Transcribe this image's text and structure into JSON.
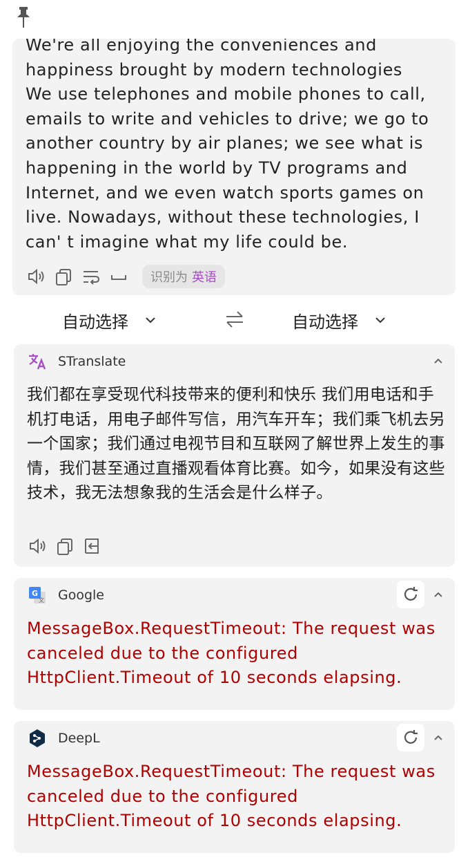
{
  "input": {
    "text": "We're all enjoying the conveniences and\nhappiness brought by modern technologies\nWe use telephones and mobile phones to call,\nemails to write and vehicles to drive; we go to\nanother country by air planes; we see what is\nhappening in the world by TV programs and\nInternet, and we even watch sports games on\nlive. Nowadays, without these technologies, I\ncan' t imagine what my life could be.",
    "detect_prefix": "识别为",
    "detect_lang": "英语",
    "icons": [
      "speaker-icon",
      "copy-icon",
      "wrap-icon",
      "space-icon"
    ]
  },
  "lang_bar": {
    "source": "自动选择",
    "target": "自动选择"
  },
  "services": [
    {
      "name": "STranslate",
      "icon": "stranslate-icon",
      "result": "我们都在享受现代科技带来的便利和快乐 我们用电话和手机打电话，用电子邮件写信，用汽车开车；我们乘飞机去另一个国家；我们通过电视节目和互联网了解世界上发生的事情，我们甚至通过直播观看体育比赛。如今，如果没有这些技术，我无法想象我的生活会是什么样子。"
    },
    {
      "name": "Google",
      "icon": "google-translate-icon",
      "result": "MessageBox.RequestTimeout: The request was canceled due to the configured HttpClient.Timeout of 10 seconds elapsing."
    },
    {
      "name": "DeepL",
      "icon": "deepl-icon",
      "result": "MessageBox.RequestTimeout: The request was canceled due to the configured HttpClient.Timeout of 10 seconds elapsing."
    }
  ],
  "colors": {
    "card_bg": "#f3f3f3",
    "accent_purple": "#a64fc2",
    "error_red": "#b00000"
  }
}
